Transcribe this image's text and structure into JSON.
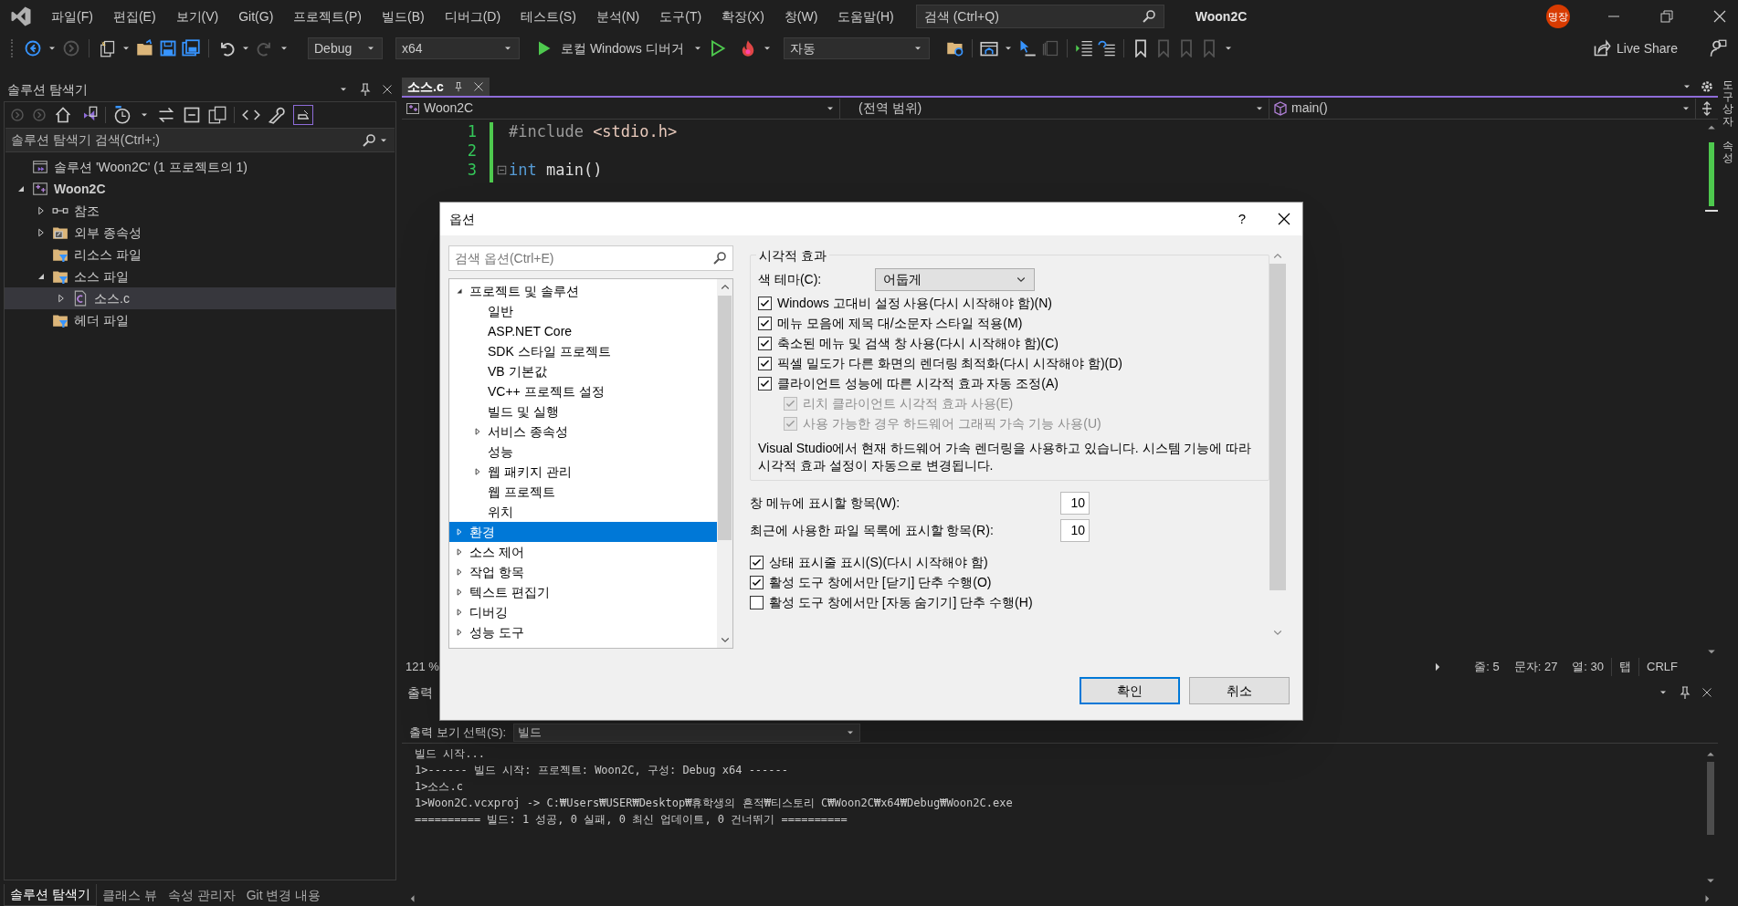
{
  "title_bar": {
    "menus": [
      "파일(F)",
      "편집(E)",
      "보기(V)",
      "Git(G)",
      "프로젝트(P)",
      "빌드(B)",
      "디버그(D)",
      "테스트(S)",
      "분석(N)",
      "도구(T)",
      "확장(X)",
      "창(W)",
      "도움말(H)"
    ],
    "search": {
      "placeholder": "검색 (Ctrl+Q)"
    },
    "solution_name": "Woon2C",
    "user_badge": "명장"
  },
  "toolbar": {
    "configuration": "Debug",
    "platform": "x64",
    "debugger": "로컬 Windows 디버거",
    "mode": "자동",
    "live_share": "Live Share"
  },
  "solution_explorer": {
    "title": "솔루션 탐색기",
    "search": {
      "placeholder": "솔루션 탐색기 검색(Ctrl+;)"
    },
    "tree": [
      {
        "label": "솔루션 'Woon2C' (1 프로젝트의 1)",
        "kind": "solution",
        "selected": false
      },
      {
        "label": "Woon2C",
        "kind": "project",
        "expanded": true,
        "selected": false,
        "children": [
          {
            "label": "참조",
            "kind": "references",
            "expanded": false,
            "selected": false
          },
          {
            "label": "외부 종속성",
            "kind": "external",
            "expanded": false,
            "selected": false
          },
          {
            "label": "리소스 파일",
            "kind": "filter",
            "selected": false
          },
          {
            "label": "소스 파일",
            "kind": "filter",
            "expanded": true,
            "selected": false,
            "children": [
              {
                "label": "소스.c",
                "kind": "cfile",
                "expanded": false,
                "selected": true
              }
            ]
          },
          {
            "label": "헤더 파일",
            "kind": "filter",
            "selected": false
          }
        ]
      }
    ],
    "bottom_tabs": [
      {
        "label": "솔루션 탐색기",
        "selected": true
      },
      {
        "label": "클래스 뷰",
        "selected": false
      },
      {
        "label": "속성 관리자",
        "selected": false
      },
      {
        "label": "Git 변경 내용",
        "selected": false
      }
    ]
  },
  "editor": {
    "tabs": [
      {
        "label": "소스.c",
        "selected": true
      }
    ],
    "nav": {
      "project": "Woon2C",
      "scope": "(전역 범위)",
      "member": "main()"
    },
    "lines": [
      {
        "number": "1",
        "tokens": [
          {
            "text": "#include ",
            "kind": "preprocessor"
          },
          {
            "text": "<stdio.h>",
            "kind": "string"
          }
        ]
      },
      {
        "number": "2"
      },
      {
        "number": "3",
        "foldable": true,
        "tokens": [
          {
            "text": "int",
            "kind": "keyword"
          },
          {
            "text": " main()",
            "kind": "plain"
          }
        ]
      }
    ],
    "zoom": "121 %",
    "status": [
      "줄: 5",
      "문자: 27",
      "열: 30",
      "탭",
      "CRLF"
    ]
  },
  "output": {
    "title": "출력",
    "source_label": "출력 보기 선택(S):",
    "source": "빌드",
    "lines": [
      "빌드 시작...",
      "1>------ 빌드 시작: 프로젝트: Woon2C, 구성: Debug x64 ------",
      "1>소스.c",
      "1>Woon2C.vcxproj -> C:₩Users₩USER₩Desktop₩휴학생의 흔적₩티스토리 C₩Woon2C₩x64₩Debug₩Woon2C.exe",
      "========== 빌드: 1 성공, 0 실패, 0 최신 업데이트, 0 건너뛰기 =========="
    ]
  },
  "side_tabs": [
    "도구 상자",
    "속성"
  ],
  "dialog": {
    "title": "옵션",
    "help": "?",
    "search": {
      "placeholder": "검색 옵션(Ctrl+E)"
    },
    "tree": [
      {
        "label": "프로젝트 및 솔루션",
        "expanded": true,
        "selected": false,
        "children": [
          {
            "label": "일반",
            "selected": false
          },
          {
            "label": "ASP.NET Core",
            "selected": false
          },
          {
            "label": "SDK 스타일 프로젝트",
            "selected": false
          },
          {
            "label": "VB 기본값",
            "selected": false
          },
          {
            "label": "VC++ 프로젝트 설정",
            "selected": false
          },
          {
            "label": "빌드 및 실행",
            "selected": false
          },
          {
            "label": "서비스 종속성",
            "expanded": false,
            "selected": false
          },
          {
            "label": "성능",
            "selected": false
          },
          {
            "label": "웹 패키지 관리",
            "expanded": false,
            "selected": false
          },
          {
            "label": "웹 프로젝트",
            "selected": false
          },
          {
            "label": "위치",
            "selected": false
          }
        ]
      },
      {
        "label": "환경",
        "expanded": false,
        "selected": true
      },
      {
        "label": "소스 제어",
        "expanded": false,
        "selected": false
      },
      {
        "label": "작업 항목",
        "expanded": false,
        "selected": false
      },
      {
        "label": "텍스트 편집기",
        "expanded": false,
        "selected": false
      },
      {
        "label": "디버깅",
        "expanded": false,
        "selected": false
      },
      {
        "label": "성능 도구",
        "expanded": false,
        "selected": false
      }
    ],
    "group_title": "시각적 효과",
    "theme_label": "색 테마(C):",
    "theme_value": "어둡게",
    "options": [
      {
        "label": "Windows 고대비 설정 사용(다시 시작해야 함)(N)",
        "checked": true,
        "disabled": false
      },
      {
        "label": "메뉴 모음에 제목 대/소문자 스타일 적용(M)",
        "checked": true,
        "disabled": false
      },
      {
        "label": "축소된 메뉴 및 검색 창 사용(다시 시작해야 함)(C)",
        "checked": true,
        "disabled": false
      },
      {
        "label": "픽셀 밀도가 다른 화면의 렌더링 최적화(다시 시작해야 함)(D)",
        "checked": true,
        "disabled": false
      },
      {
        "label": "클라이언트 성능에 따른 시각적 효과 자동 조정(A)",
        "checked": true,
        "disabled": false,
        "children": [
          {
            "label": "리치 클라이언트 시각적 효과 사용(E)",
            "checked": true,
            "disabled": true
          },
          {
            "label": "사용 가능한 경우 하드웨어 그래픽 가속 기능 사용(U)",
            "checked": true,
            "disabled": true
          }
        ]
      }
    ],
    "note": "Visual Studio에서 현재 하드웨어 가속 렌더링을 사용하고 있습니다. 시스템 기능에 따라 시각적 효과 설정이 자동으로 변경됩니다.",
    "fields": [
      {
        "label": "창 메뉴에 표시할 항목(W):",
        "value": "10"
      },
      {
        "label": "최근에 사용한 파일 목록에 표시할 항목(R):",
        "value": "10"
      }
    ],
    "more_options": [
      {
        "label": "상태 표시줄 표시(S)(다시 시작해야 함)",
        "checked": true
      },
      {
        "label": "활성 도구 창에서만 [닫기] 단추 수행(O)",
        "checked": true
      },
      {
        "label": "활성 도구 창에서만 [자동 숨기기] 단추 수행(H)",
        "checked": false
      }
    ],
    "buttons": [
      {
        "label": "확인",
        "default": true
      },
      {
        "label": "취소",
        "default": false
      }
    ]
  }
}
